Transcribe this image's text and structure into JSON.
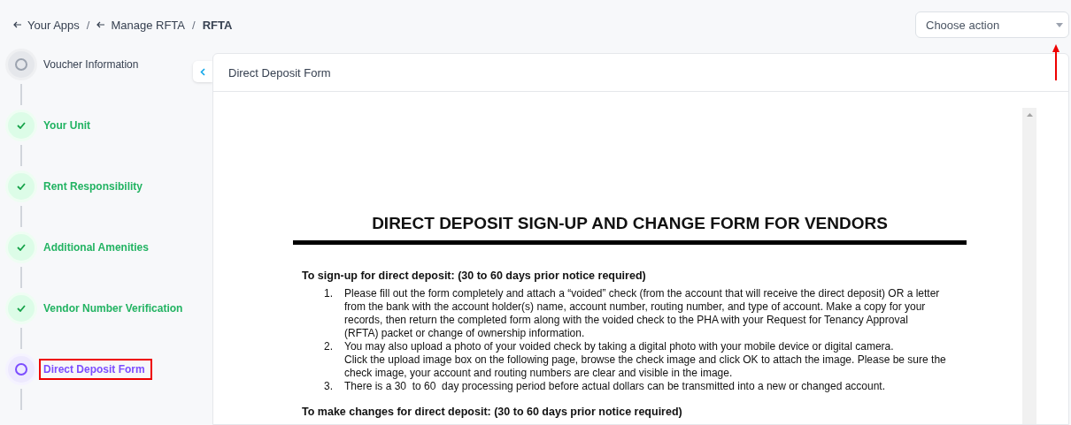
{
  "breadcrumb_separator": "/",
  "breadcrumbs": [
    {
      "label": "Your Apps",
      "kind": "back"
    },
    {
      "label": "Manage RFTA",
      "kind": "back"
    },
    {
      "label": "RFTA",
      "kind": "current"
    }
  ],
  "action_select": {
    "placeholder": "Choose action",
    "pointed_at": true
  },
  "steps": [
    {
      "label": "Voucher Information",
      "completed": false,
      "selected": false,
      "highlighted": false
    },
    {
      "label": "Your Unit",
      "completed": true,
      "selected": false,
      "highlighted": false
    },
    {
      "label": "Rent Responsibility",
      "completed": true,
      "selected": false,
      "highlighted": false
    },
    {
      "label": "Additional Amenities",
      "completed": true,
      "selected": false,
      "highlighted": false
    },
    {
      "label": "Vendor Number Verification",
      "completed": true,
      "selected": false,
      "highlighted": false
    },
    {
      "label": "Direct Deposit Form",
      "completed": false,
      "selected": true,
      "highlighted": true
    }
  ],
  "panel": {
    "title": "Direct Deposit Form"
  },
  "document": {
    "title": "DIRECT DEPOSIT SIGN-UP AND CHANGE FORM FOR VENDORS",
    "sections": [
      {
        "heading": "To sign-up for direct deposit: (30  to 60  days prior notice required)",
        "items": [
          {
            "number": "1.",
            "lines": [
              "Please fill out the form completely and attach a “voided” check (from the account that will receive the direct deposit) OR a letter",
              "from the bank with the account holder(s) name, account number, routing number, and type of account. Make a copy for your",
              "records, then return the completed form along with the voided check to the PHA with your Request for Tenancy Approval",
              "(RFTA) packet or change of ownership information."
            ]
          },
          {
            "number": "2.",
            "lines": [
              "You may also upload a photo of your voided check by taking a digital photo with your mobile device or digital camera.",
              "Click the upload image box on the following page, browse the check image and click OK to attach the image. Please be sure the",
              "check image, your account and routing numbers are clear and visible in the image."
            ]
          },
          {
            "number": "3.",
            "lines": [
              "There is a 30  to 60  day processing period before actual dollars can be transmitted into a new or changed account."
            ]
          }
        ]
      },
      {
        "heading": "To make changes for direct deposit: (30  to 60  days prior notice required)"
      }
    ]
  }
}
